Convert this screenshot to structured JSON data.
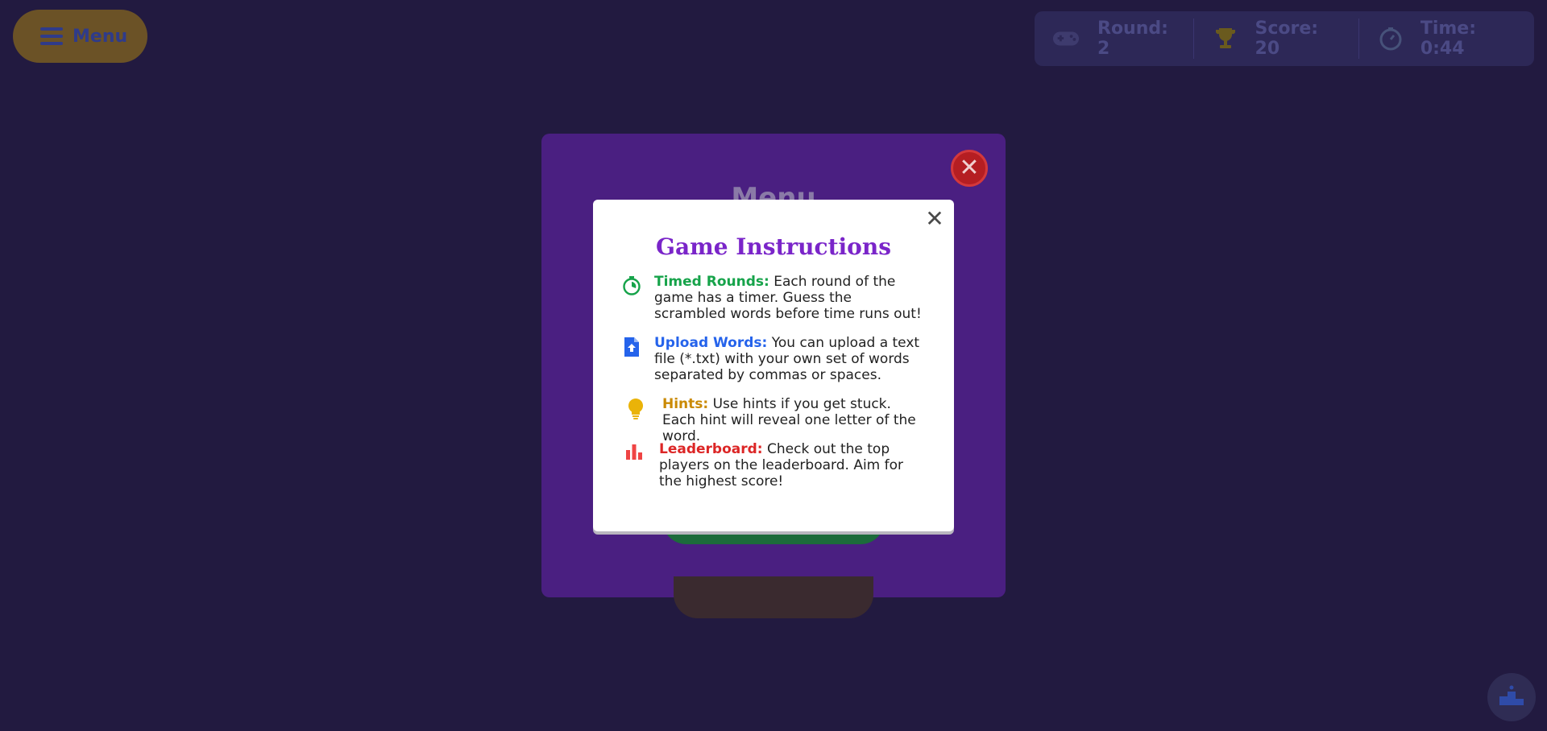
{
  "header": {
    "menu_label": "Menu",
    "round_text": "Round: 2",
    "score_text": "Score: 20",
    "time_text": "Time: 0:44"
  },
  "menu_panel": {
    "title": "Menu"
  },
  "instructions": {
    "title": "Game Instructions",
    "close_symbol": "✕",
    "items": [
      {
        "label": "Timed Rounds:",
        "text": "Each round of the game has a timer. Guess the scrambled words before time runs out!",
        "icon": "stopwatch-icon",
        "color": "#16a34a"
      },
      {
        "label": "Upload Words:",
        "text": "You can upload a text file (*.txt) with your own set of words separated by commas or spaces.",
        "icon": "file-upload-icon",
        "color": "#2563eb"
      },
      {
        "label": "Hints:",
        "text": "Use hints if you get stuck. Each hint will reveal one letter of the word.",
        "icon": "lightbulb-icon",
        "color": "#ca8a04"
      },
      {
        "label": "Leaderboard:",
        "text": "Check out the top players on the leaderboard. Aim for the highest score!",
        "icon": "bar-chart-icon",
        "color": "#dc2626"
      }
    ]
  },
  "colors": {
    "background": "#221a40",
    "modal_title": "#7a25c9",
    "menu_panel": "#4a1f81"
  }
}
